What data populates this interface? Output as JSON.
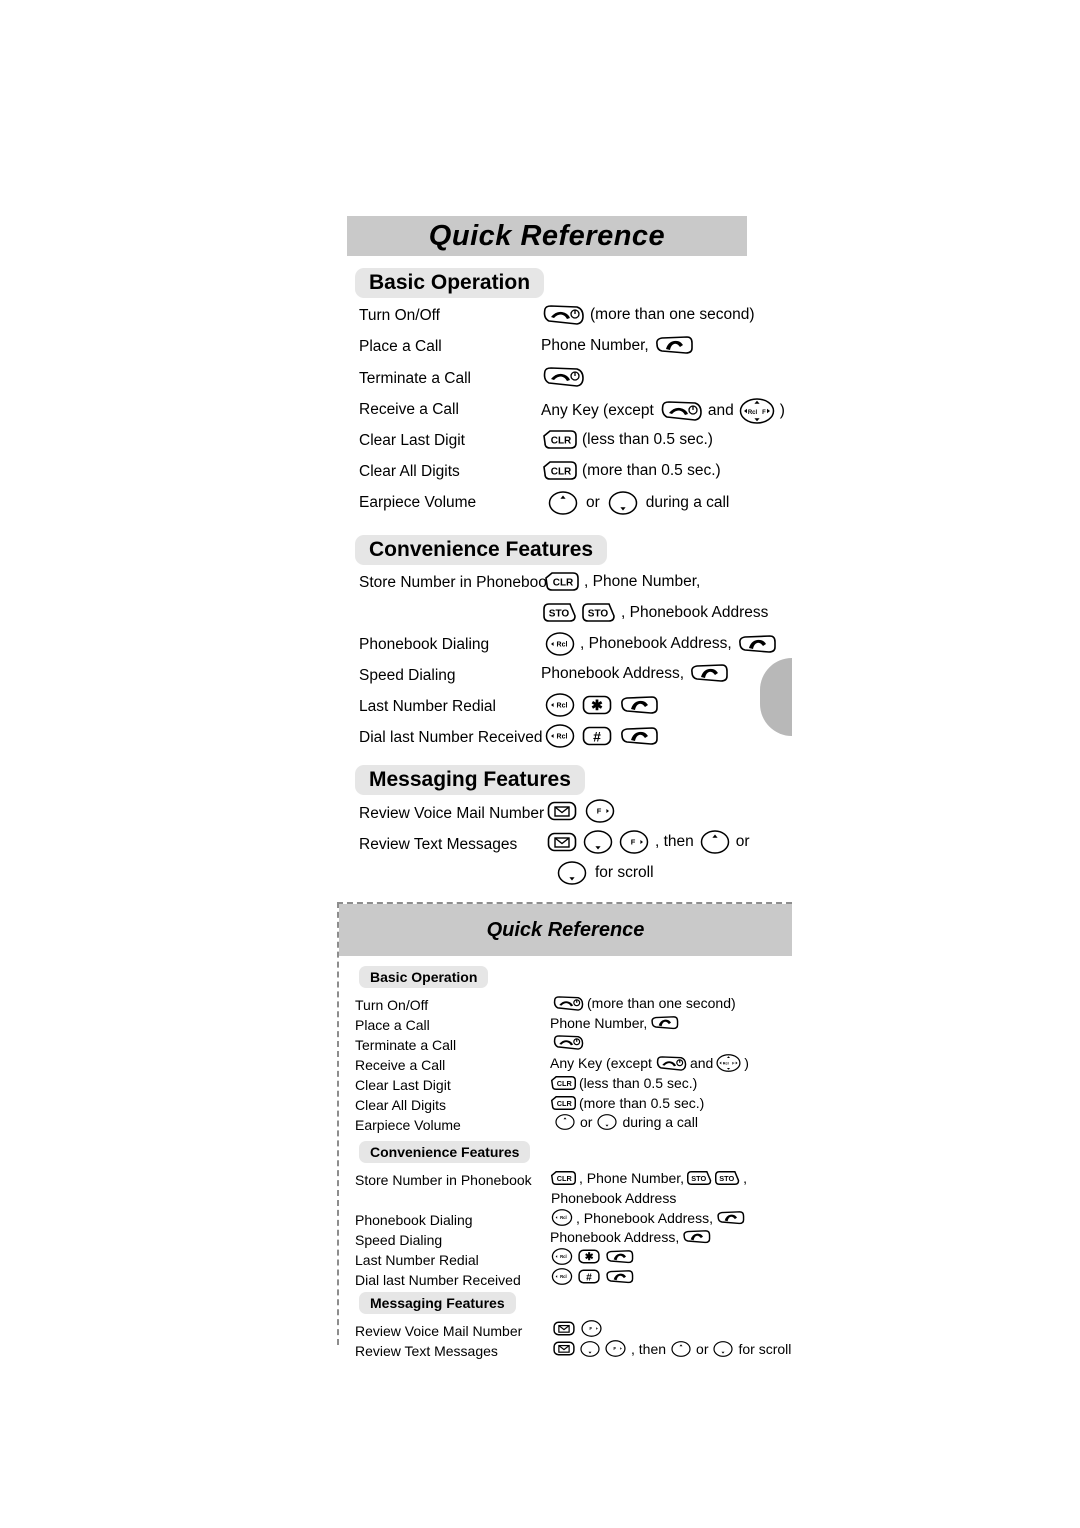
{
  "document": {
    "title": "Quick Reference"
  },
  "sections": {
    "basic": {
      "heading": "Basic Operation",
      "rows": [
        {
          "label": "Turn On/Off",
          "note_after": "(more than one second)"
        },
        {
          "label": "Place a Call",
          "note_before": "Phone Number,"
        },
        {
          "label": "Terminate a Call"
        },
        {
          "label": "Receive a Call",
          "note_before": "Any Key (except",
          "note_mid": "and",
          "note_after": ")"
        },
        {
          "label": "Clear Last Digit",
          "note_after": "(less than 0.5 sec.)"
        },
        {
          "label": "Clear All Digits",
          "note_after": "(more than 0.5 sec.)"
        },
        {
          "label": "Earpiece Volume",
          "note_mid": "or",
          "note_after": "during a call"
        }
      ]
    },
    "convenience": {
      "heading": "Convenience Features",
      "rows": [
        {
          "label": "Store Number in Phonebook",
          "note_after": ", Phone Number,",
          "note2": ", Phonebook Address"
        },
        {
          "label": "Phonebook Dialing",
          "note_after": ", Phonebook Address,"
        },
        {
          "label": "Speed Dialing",
          "note_before": "Phonebook Address,"
        },
        {
          "label": "Last Number Redial"
        },
        {
          "label": "Dial last Number Received"
        }
      ]
    },
    "messaging": {
      "heading": "Messaging Features",
      "rows": [
        {
          "label": "Review Voice Mail Number"
        },
        {
          "label": "Review Text Messages",
          "note_mid": ", then",
          "note_after": "or",
          "note2": "for scroll"
        }
      ]
    }
  },
  "keys": {
    "end_power": "end-power-key",
    "send": "send-key",
    "clr": "CLR",
    "sto": "STO",
    "rcl": "Rcl",
    "nav_left_label": "Rcl",
    "nav_right_label": "F",
    "star": "✱",
    "hash": "#",
    "envelope": "envelope-key",
    "vol_up": "volume-up-key",
    "vol_down": "volume-down-key",
    "f_right": "F"
  },
  "colors": {
    "banner_gray": "#c9c9c9",
    "pill_gray": "#e6e6e6",
    "tab_gray": "#b8b8b8",
    "dash_gray": "#8d8d8d"
  }
}
